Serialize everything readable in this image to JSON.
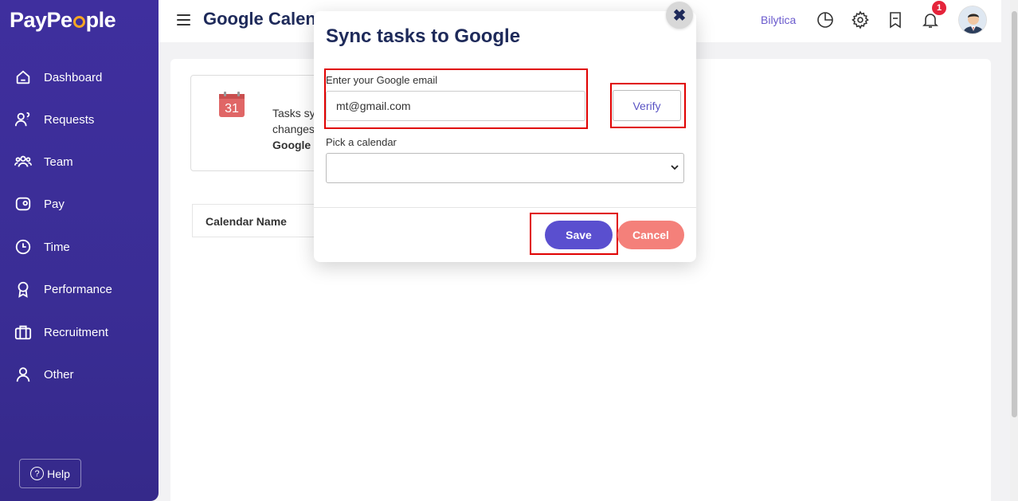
{
  "app": {
    "logo_text_1": "PayPe",
    "logo_text_2": "ple"
  },
  "sidebar": {
    "items": [
      {
        "label": "Dashboard",
        "icon": "home-icon"
      },
      {
        "label": "Requests",
        "icon": "requests-icon"
      },
      {
        "label": "Team",
        "icon": "team-icon"
      },
      {
        "label": "Pay",
        "icon": "pay-icon"
      },
      {
        "label": "Time",
        "icon": "clock-icon"
      },
      {
        "label": "Performance",
        "icon": "award-icon"
      },
      {
        "label": "Recruitment",
        "icon": "briefcase-icon"
      },
      {
        "label": "Other",
        "icon": "user-icon"
      }
    ],
    "help_label": "Help"
  },
  "header": {
    "title": "Google Calendar",
    "company": "Bilytica",
    "notification_count": "1"
  },
  "content": {
    "info_text_1": "Tasks sy",
    "info_text_2": "changes",
    "info_text_3": "Google",
    "calendar_day": "31",
    "table_header": "Calendar Name"
  },
  "modal": {
    "title": "Sync tasks to Google",
    "email_label": "Enter your Google email",
    "email_value": "mt@gmail.com",
    "verify_label": "Verify",
    "calendar_label": "Pick a calendar",
    "calendar_value": "",
    "save_label": "Save",
    "cancel_label": "Cancel",
    "close_symbol": "✖"
  },
  "colors": {
    "sidebar": "#3f2f9e",
    "accent": "#5a4fcf",
    "cancel": "#f4807a",
    "highlight": "#e00000"
  }
}
